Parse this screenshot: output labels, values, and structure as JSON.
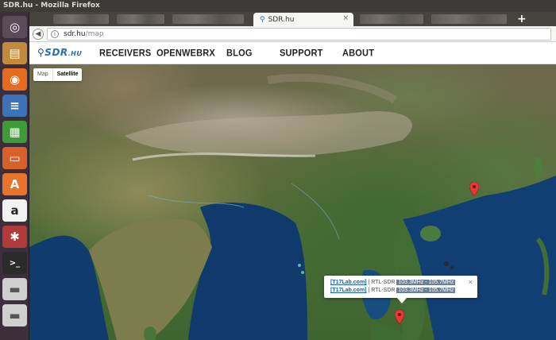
{
  "window": {
    "title": "SDR.hu - Mozilla Firefox"
  },
  "tabs": {
    "active_label": "SDR.hu",
    "close_glyph": "×",
    "new_tab_glyph": "+"
  },
  "urlbar": {
    "host": "sdr.hu",
    "path": "/map"
  },
  "launcher": {
    "items": [
      {
        "name": "ubuntu-dash-icon",
        "glyph": "◎",
        "bg": "#5a4b5a",
        "fg": "#ffffff"
      },
      {
        "name": "files-icon",
        "glyph": "▤",
        "bg": "#c48a3c",
        "fg": "#ffffff"
      },
      {
        "name": "firefox-icon",
        "glyph": "◉",
        "bg": "#e66b1f",
        "fg": "#ffffff"
      },
      {
        "name": "writer-icon",
        "glyph": "≡",
        "bg": "#3b72b8",
        "fg": "#ffffff"
      },
      {
        "name": "calc-icon",
        "glyph": "▦",
        "bg": "#3f9a3a",
        "fg": "#ffffff"
      },
      {
        "name": "impress-icon",
        "glyph": "▭",
        "bg": "#d8602a",
        "fg": "#ffffff"
      },
      {
        "name": "software-center-icon",
        "glyph": "A",
        "bg": "#e8742c",
        "fg": "#ffffff"
      },
      {
        "name": "amazon-icon",
        "glyph": "a",
        "bg": "#f2f2f2",
        "fg": "#222222"
      },
      {
        "name": "settings-icon",
        "glyph": "✱",
        "bg": "#b33a3a",
        "fg": "#ffffff"
      },
      {
        "name": "terminal-icon",
        "glyph": ">_",
        "bg": "#2b2b2b",
        "fg": "#ffffff"
      },
      {
        "name": "drive-icon",
        "glyph": "▬",
        "bg": "#cfcfcf",
        "fg": "#555555"
      },
      {
        "name": "drive-2-icon",
        "glyph": "▬",
        "bg": "#cfcfcf",
        "fg": "#555555"
      }
    ]
  },
  "site": {
    "logo_main": "SDR",
    "logo_suffix": ".HU",
    "nav": [
      "RECEIVERS",
      "OPENWEBRX",
      "BLOG",
      "SUPPORT",
      "ABOUT"
    ]
  },
  "map": {
    "type_buttons": [
      "Map",
      "Satellite"
    ],
    "active_type": "Satellite",
    "infowindow": {
      "close_glyph": "×",
      "rows": [
        {
          "receiver": "[T17Lab.com]",
          "sep": " | RTL-SDR ",
          "freq": "103.3MHz - 105.7MHz"
        },
        {
          "receiver": "[T17Lab.com]",
          "sep": " | RTL-SDR ",
          "freq": "103.3MHz - 105.7MHz"
        }
      ]
    },
    "marker_color": "#e53935"
  }
}
